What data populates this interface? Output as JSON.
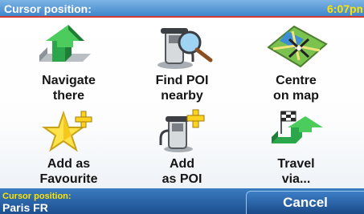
{
  "header": {
    "title": "Cursor position:",
    "time": "6:07pm"
  },
  "menu": {
    "items": [
      {
        "label": "Navigate\nthere",
        "icon": "navigate-arrow-icon"
      },
      {
        "label": "Find POI\nnearby",
        "icon": "find-poi-magnifier-icon"
      },
      {
        "label": "Centre\non map",
        "icon": "centre-map-crosshair-icon"
      },
      {
        "label": "Add as\nFavourite",
        "icon": "favourite-star-icon"
      },
      {
        "label": "Add\nas POI",
        "icon": "add-poi-pump-icon"
      },
      {
        "label": "Travel\nvia...",
        "icon": "travel-via-flag-icon"
      }
    ]
  },
  "footer": {
    "caption": "Cursor position:",
    "location": "Paris FR",
    "cancel_label": "Cancel"
  },
  "colors": {
    "header_blue": "#4a8fd2",
    "time_yellow": "#ffe400",
    "footer_blue": "#1c4f8f",
    "accent_green": "#2ea84a",
    "separator_red": "#d43a2e"
  }
}
